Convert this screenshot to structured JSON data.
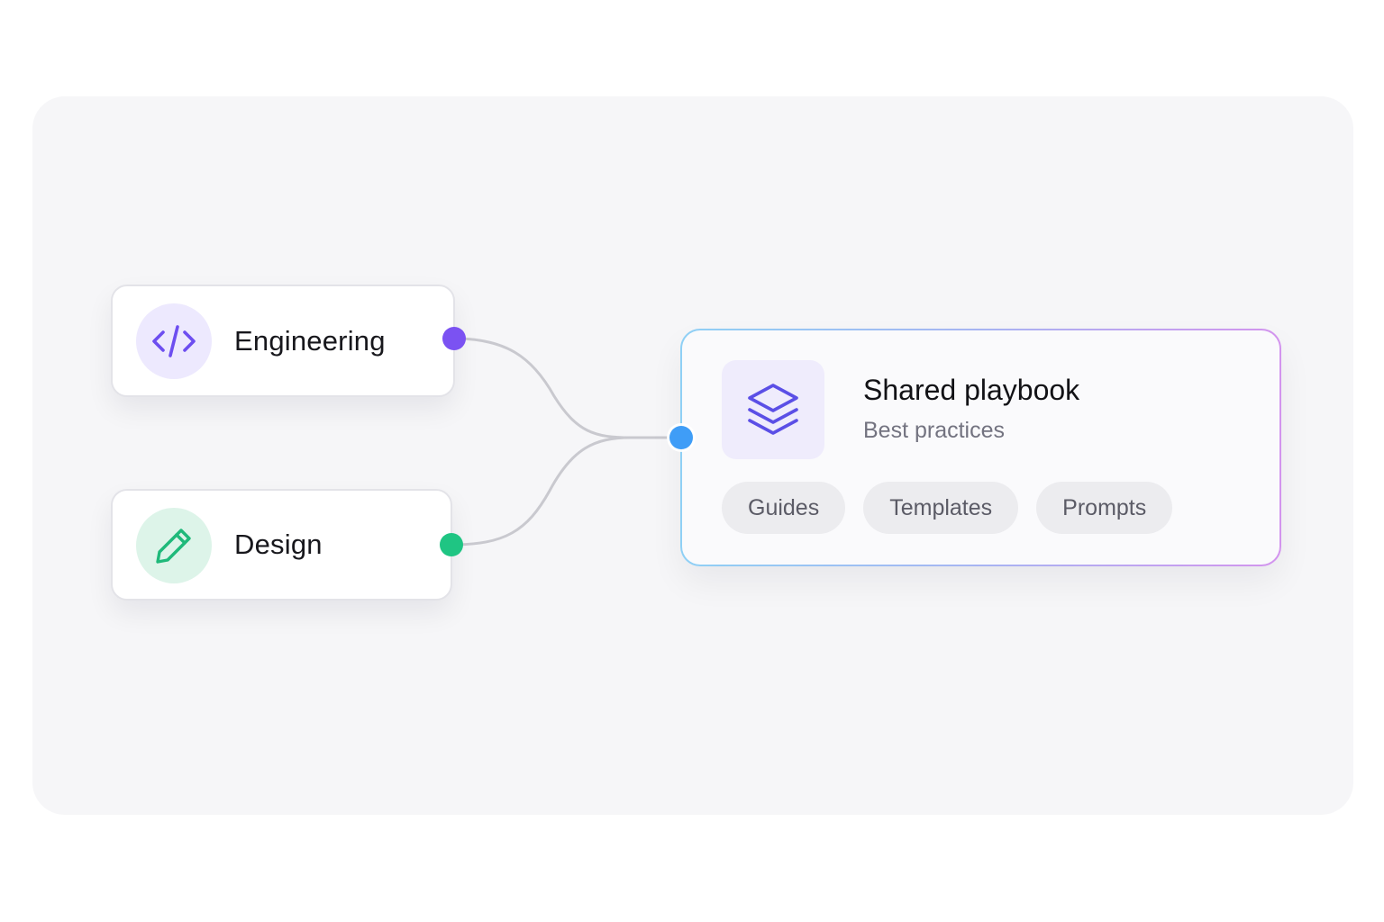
{
  "sources": [
    {
      "label": "Engineering",
      "icon": "code-icon",
      "accent": "#6d4ef0",
      "port_color": "#7b52f2"
    },
    {
      "label": "Design",
      "icon": "pencil-icon",
      "accent": "#1fb97a",
      "port_color": "#1fc583"
    }
  ],
  "target": {
    "title": "Shared playbook",
    "subtitle": "Best practices",
    "icon": "layers-icon",
    "accent": "#5b4fe6",
    "port_color": "#3f9df7",
    "tags": [
      "Guides",
      "Templates",
      "Prompts"
    ]
  },
  "colors": {
    "border_gradient": [
      "#8fd0f5",
      "#d394ee"
    ],
    "connector": "#c9c9cf"
  }
}
